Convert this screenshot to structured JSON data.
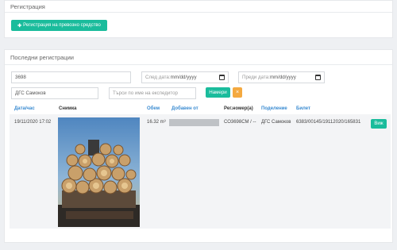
{
  "registration": {
    "title": "Регистрация",
    "button_label": "Регистрация на превозно средство"
  },
  "recent": {
    "title": "Последни регистрации",
    "filters": {
      "reg_number_value": "3698",
      "date_from_placeholder": "След дата:",
      "date_from_format": "mm/dd/yyyy",
      "date_to_placeholder": "Преди дата:",
      "date_to_format": "mm/dd/yyyy",
      "division_value": "ДГС Самоков",
      "forwarder_placeholder": "Търси по име на експедитор",
      "search_button": "Намери",
      "clear_button": "×"
    },
    "columns": [
      "Дата/час",
      "Снимка",
      "Обем",
      "Добавен от",
      "Рег.номер(а)",
      "Поделение",
      "Билет"
    ],
    "row": {
      "datetime": "19/11/2020 17:02",
      "volume": "16.32 m³",
      "reg_number": "СО3698СМ / --",
      "division": "ДГС Самоков",
      "ticket": "6383/00145/19112020/165831",
      "action_label": "Виж"
    }
  },
  "colors": {
    "accent_green": "#1abc9c",
    "accent_orange": "#f4a940",
    "header_blue": "#3a8bd1"
  }
}
